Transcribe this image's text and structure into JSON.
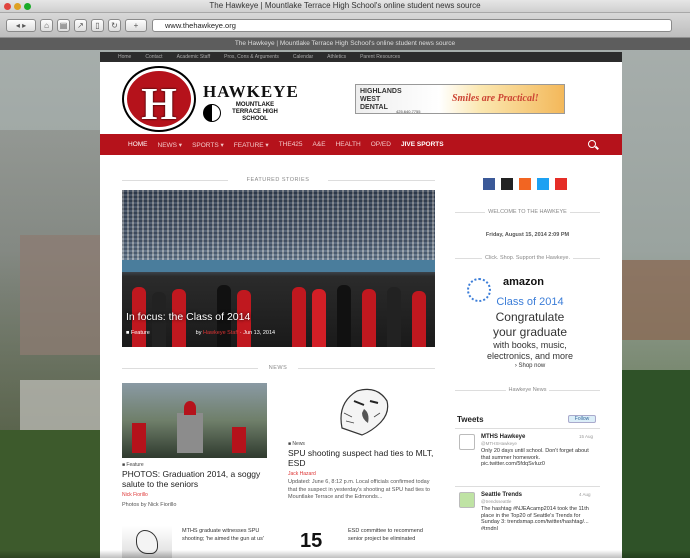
{
  "window": {
    "title": "The Hawkeye | Mountlake Terrace High School's online student news source",
    "url": "www.thehawkeye.org",
    "tab": "The Hawkeye | Mountlake Terrace High School's online student news source"
  },
  "topnav": {
    "items": [
      "Home",
      "Contact",
      "Academic Staff",
      "Pros, Cons & Arguments",
      "Calendar",
      "Athletics",
      "Parent Resources"
    ]
  },
  "brand": {
    "logo_letter": "H",
    "name": "HAWKEYE",
    "school": "MOUNTLAKE TERRACE HIGH SCHOOL"
  },
  "ad": {
    "line1": "HIGHLANDS",
    "line2": "WEST",
    "line3": "DENTAL",
    "slogan": "Smiles are Practical!",
    "phone": "425.640.7755"
  },
  "nav": {
    "items": [
      "HOME",
      "NEWS ▾",
      "SPORTS ▾",
      "FEATURE ▾",
      "THE425",
      "A&E",
      "HEALTH",
      "OP/ED",
      "JIVE SPORTS"
    ]
  },
  "featured": {
    "header": "FEATURED STORIES",
    "caption": "In focus: the Class of 2014",
    "category": "Feature",
    "by": "by",
    "author": "Hawkeye Staff",
    "date": "Jun 13, 2014"
  },
  "news": {
    "header": "NEWS",
    "article1": {
      "category": "Feature",
      "title": "PHOTOS: Graduation 2014, a soggy salute to the seniors",
      "author": "Nick Fiorillo",
      "excerpt": "Photos by Nick Fiorillo"
    },
    "article2": {
      "category": "News",
      "title": "SPU shooting suspect had ties to MLT, ESD",
      "author": "Jack Hazard",
      "excerpt": "Updated: June 6, 8:12 p.m. Local officials confirmed today that the suspect in yesterday's shooting at SPU had ties to Mountlake Terrace and the Edmonds..."
    },
    "article3": {
      "title": "MTHS graduate witnesses SPU shooting; 'he aimed the gun at us'"
    },
    "article4": {
      "title": "ESD committee to recommend senior project be eliminated"
    },
    "big_number": "15"
  },
  "sidebar": {
    "welcome": "WELCOME TO THE HAWKEYE",
    "date": "Friday, August 15, 2014 2:09 PM",
    "support": "Click. Shop. Support the Hawkeye.",
    "amazon": {
      "logo": "amazon",
      "line1": "Class of 2014",
      "line2": "Congratulate",
      "line3": "your graduate",
      "line4": "with books, music,",
      "line5": "electronics, and more",
      "shop": "› Shop now"
    },
    "news_link": "Hawkeye News",
    "tweets_title": "Tweets",
    "follow": "Follow",
    "tweets": [
      {
        "name": "MTHS Hawkeye",
        "handle": "@MTHSHawkeye",
        "date": "15 Aug",
        "text": "Only 20 days until school. Don't forget about that summer homework. pic.twitter.com/5fdqSvIuz0"
      },
      {
        "name": "Seattle Trends",
        "handle": "@trendsseattle",
        "date": "4 Aug",
        "text": "The hashtag #NJEAcamp2014 took the 11th place in the Top20 of Seattle's Trends for Sunday 3: trendsmap.com/twitter/hashtag/... #trndnl"
      }
    ]
  },
  "colors": {
    "brand_red": "#b5121b",
    "facebook": "#3b5998",
    "twitter": "#1da1f2",
    "rss": "#f26522",
    "youtube": "#e52d27"
  }
}
